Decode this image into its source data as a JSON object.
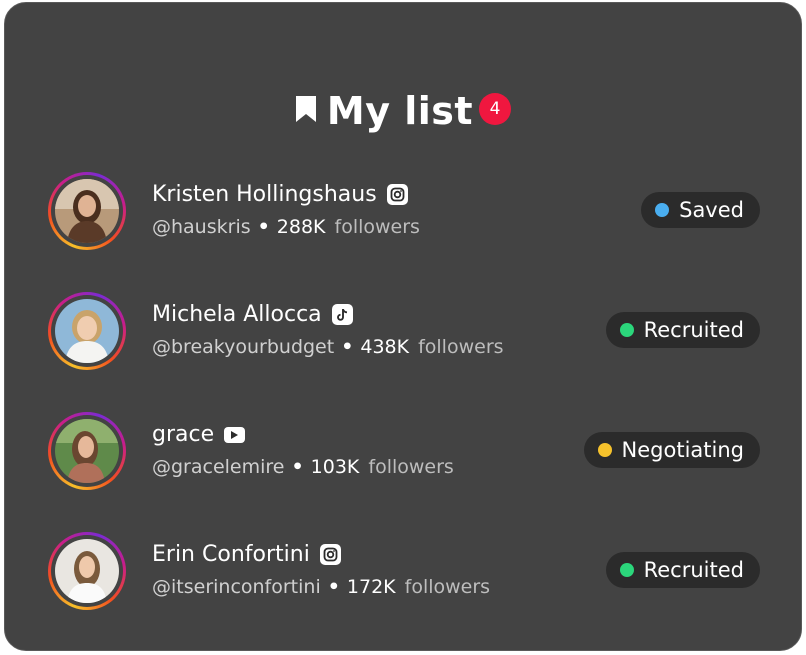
{
  "header": {
    "title": "My list",
    "count": "4",
    "badge_color": "#f0173f"
  },
  "creators": [
    {
      "name": "Kristen Hollingshaus",
      "platform": "instagram-icon",
      "handle": "@hauskris",
      "followers": "288K",
      "followers_label": "followers",
      "status": "Saved",
      "status_color": "#4aaef0"
    },
    {
      "name": "Michela Allocca",
      "platform": "tiktok-icon",
      "handle": "@breakyourbudget",
      "followers": "438K",
      "followers_label": "followers",
      "status": "Recruited",
      "status_color": "#2bd67b"
    },
    {
      "name": "grace",
      "platform": "youtube-icon",
      "handle": "@gracelemire",
      "followers": "103K",
      "followers_label": "followers",
      "status": "Negotiating",
      "status_color": "#f6c22c"
    },
    {
      "name": "Erin Confortini",
      "platform": "instagram-icon",
      "handle": "@itserinconfortini",
      "followers": "172K",
      "followers_label": "followers",
      "status": "Recruited",
      "status_color": "#2bd67b"
    }
  ]
}
